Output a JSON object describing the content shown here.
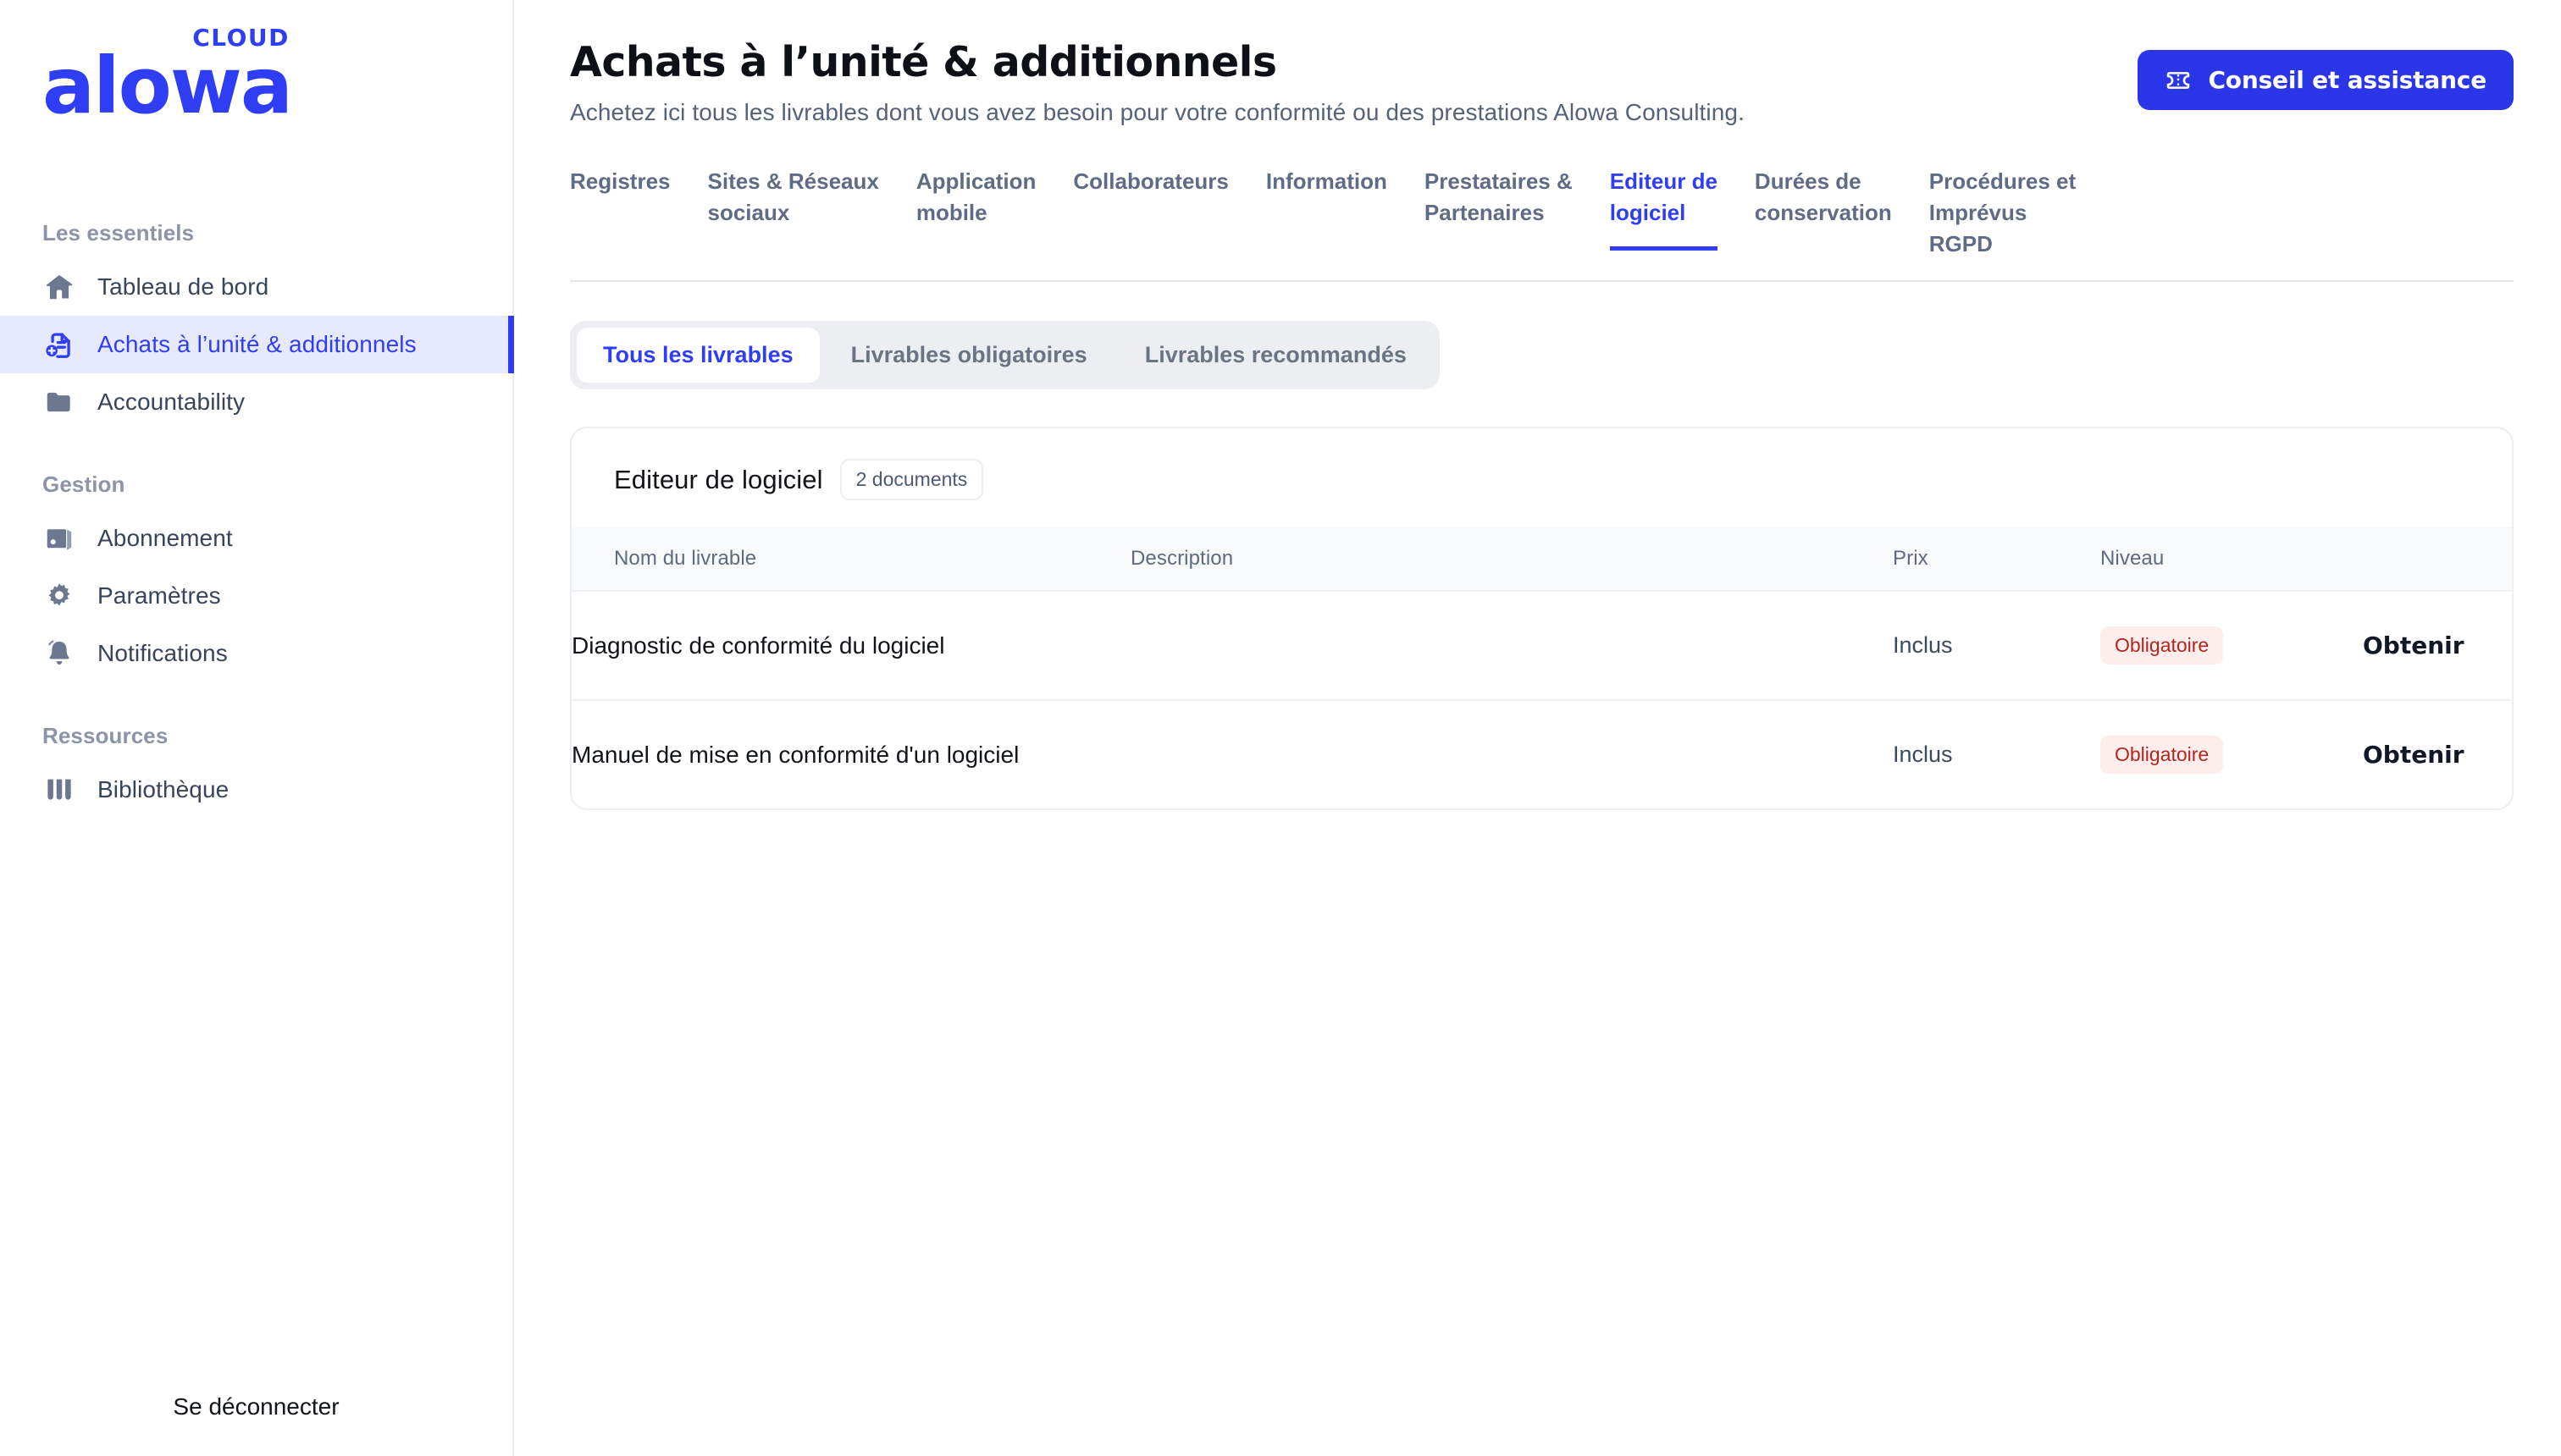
{
  "brand": {
    "name": "alowa",
    "suffix": "CLOUD",
    "color": "#2f3ef5"
  },
  "sidebar": {
    "sections": [
      {
        "label": "Les essentiels",
        "items": [
          {
            "label": "Tableau de bord",
            "icon": "home-icon",
            "active": false
          },
          {
            "label": "Achats à l’unité & additionnels",
            "icon": "document-plus-icon",
            "active": true
          },
          {
            "label": "Accountability",
            "icon": "folder-icon",
            "active": false
          }
        ]
      },
      {
        "label": "Gestion",
        "items": [
          {
            "label": "Abonnement",
            "icon": "wallet-icon",
            "active": false
          },
          {
            "label": "Paramètres",
            "icon": "gear-icon",
            "active": false
          },
          {
            "label": "Notifications",
            "icon": "bell-icon",
            "active": false
          }
        ]
      },
      {
        "label": "Ressources",
        "items": [
          {
            "label": "Bibliothèque",
            "icon": "books-icon",
            "active": false
          }
        ]
      }
    ],
    "logout_label": "Se déconnecter"
  },
  "header": {
    "title": "Achats à l’unité & additionnels",
    "subtitle": "Achetez ici tous les livrables dont vous avez besoin pour votre conformité ou des prestations Alowa Consulting.",
    "support_button": {
      "label": "Conseil et assistance",
      "icon": "ticket-icon",
      "color": "#2b36e8"
    }
  },
  "category_tabs": {
    "active_index": 6,
    "items": [
      {
        "label": "Registres"
      },
      {
        "label": "Sites & Réseaux\nsociaux"
      },
      {
        "label": "Application\nmobile"
      },
      {
        "label": "Collaborateurs"
      },
      {
        "label": "Information"
      },
      {
        "label": "Prestataires &\nPartenaires"
      },
      {
        "label": "Editeur de\nlogiciel"
      },
      {
        "label": "Durées de\nconservation"
      },
      {
        "label": "Procédures et Imprévus\nRGPD"
      }
    ]
  },
  "filter_tabs": {
    "active_index": 0,
    "items": [
      {
        "label": "Tous les livrables"
      },
      {
        "label": "Livrables obligatoires"
      },
      {
        "label": "Livrables recommandés"
      }
    ]
  },
  "card": {
    "title": "Editeur de logiciel",
    "count_badge": "2 documents",
    "columns": {
      "name": "Nom du livrable",
      "description": "Description",
      "price": "Prix",
      "level": "Niveau",
      "action": ""
    },
    "rows": [
      {
        "name": "Diagnostic de conformité du logiciel",
        "description": "",
        "price": "Inclus",
        "level": "Obligatoire",
        "action": "Obtenir"
      },
      {
        "name": "Manuel de mise en conformité d'un logiciel",
        "description": "",
        "price": "Inclus",
        "level": "Obligatoire",
        "action": "Obtenir"
      }
    ]
  },
  "colors": {
    "accent": "#2f3ef5",
    "accent_button": "#2b36e8",
    "active_nav_bg": "#e7eaff",
    "badge_bg": "#fdeeed",
    "badge_text": "#b3261e",
    "table_header_bg": "#f8f9fb",
    "muted_text": "#5d6a80"
  }
}
